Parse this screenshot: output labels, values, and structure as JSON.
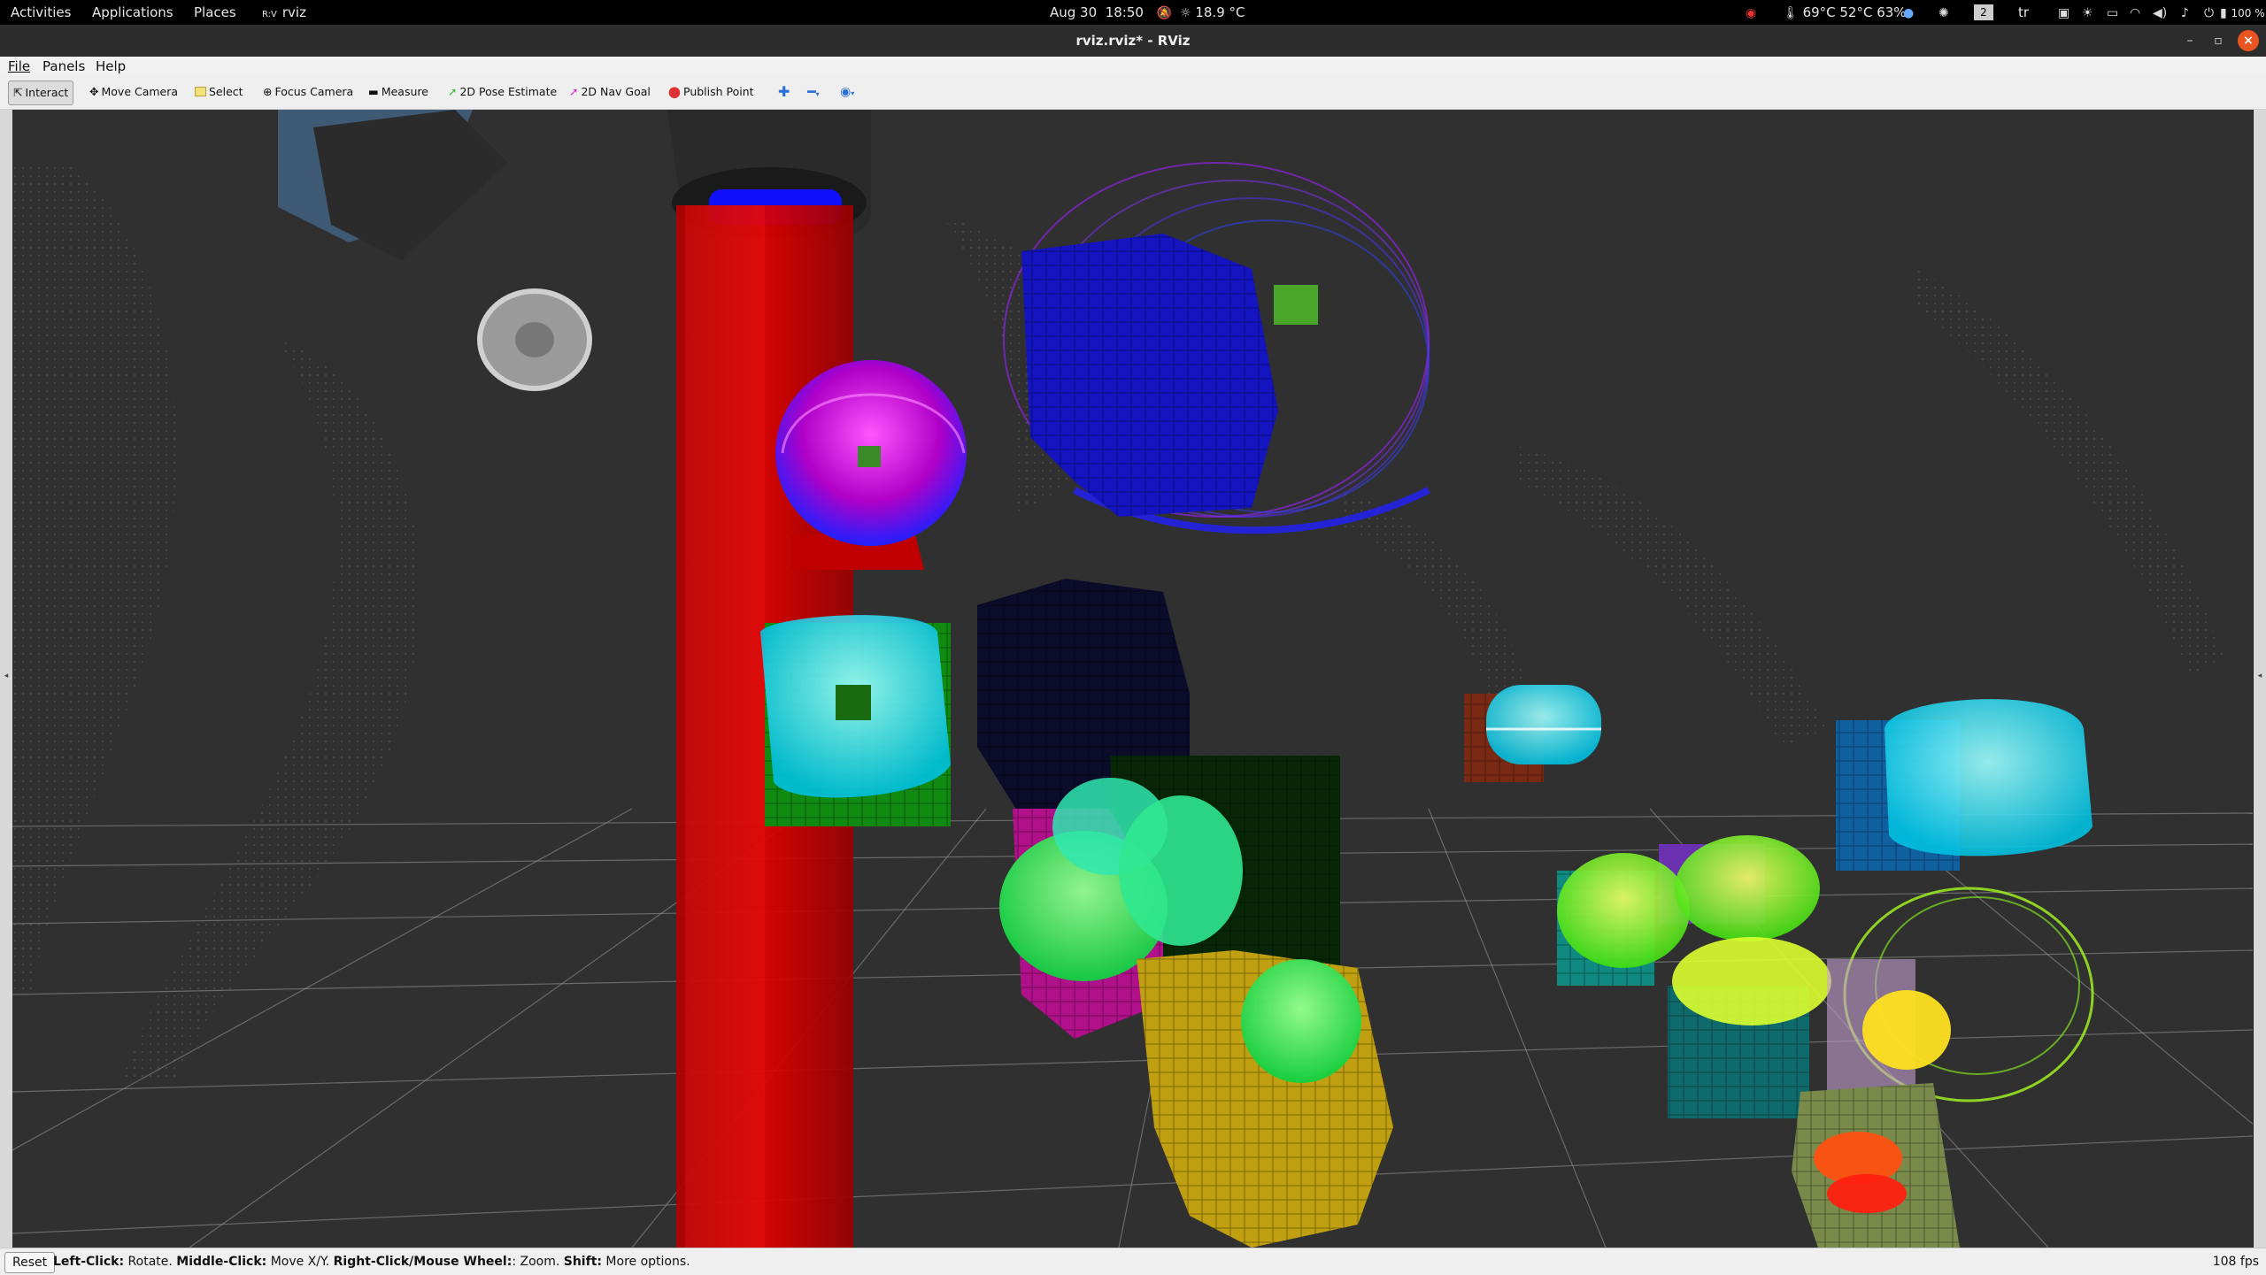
{
  "topbar": {
    "activities": "Activities",
    "applications": "Applications",
    "places": "Places",
    "app_name": "rviz",
    "app_badge": "R:V",
    "date": "Aug 30",
    "time": "18:50",
    "weather": "18.9 °C",
    "sensors": "69°C 52°C 63%",
    "workspace": "2",
    "keyboard_layout": "tr",
    "battery": "100 %"
  },
  "window": {
    "title": "rviz.rviz* - RViz",
    "minimize": "–",
    "maximize": "▫",
    "close": "×"
  },
  "menu": {
    "file": "File",
    "panels": "Panels",
    "help": "Help"
  },
  "toolbar": {
    "interact": "Interact",
    "move_camera": "Move Camera",
    "select": "Select",
    "focus_camera": "Focus Camera",
    "measure": "Measure",
    "pose_estimate": "2D Pose Estimate",
    "nav_goal": "2D Nav Goal",
    "publish_point": "Publish Point"
  },
  "statusbar": {
    "reset": "Reset",
    "help_parts": [
      {
        "b": "Left-Click:",
        "t": " Rotate. "
      },
      {
        "b": "Middle-Click:",
        "t": " Move X/Y. "
      },
      {
        "b": "Right-Click/Mouse Wheel:",
        "t": ": Zoom. "
      },
      {
        "b": "Shift:",
        "t": " More options."
      }
    ],
    "fps": "108 fps"
  },
  "colors": {
    "viewport_bg": "#303030",
    "grid": "#9a9a9a",
    "close_button": "#e95420",
    "red_column": "#d00000"
  }
}
